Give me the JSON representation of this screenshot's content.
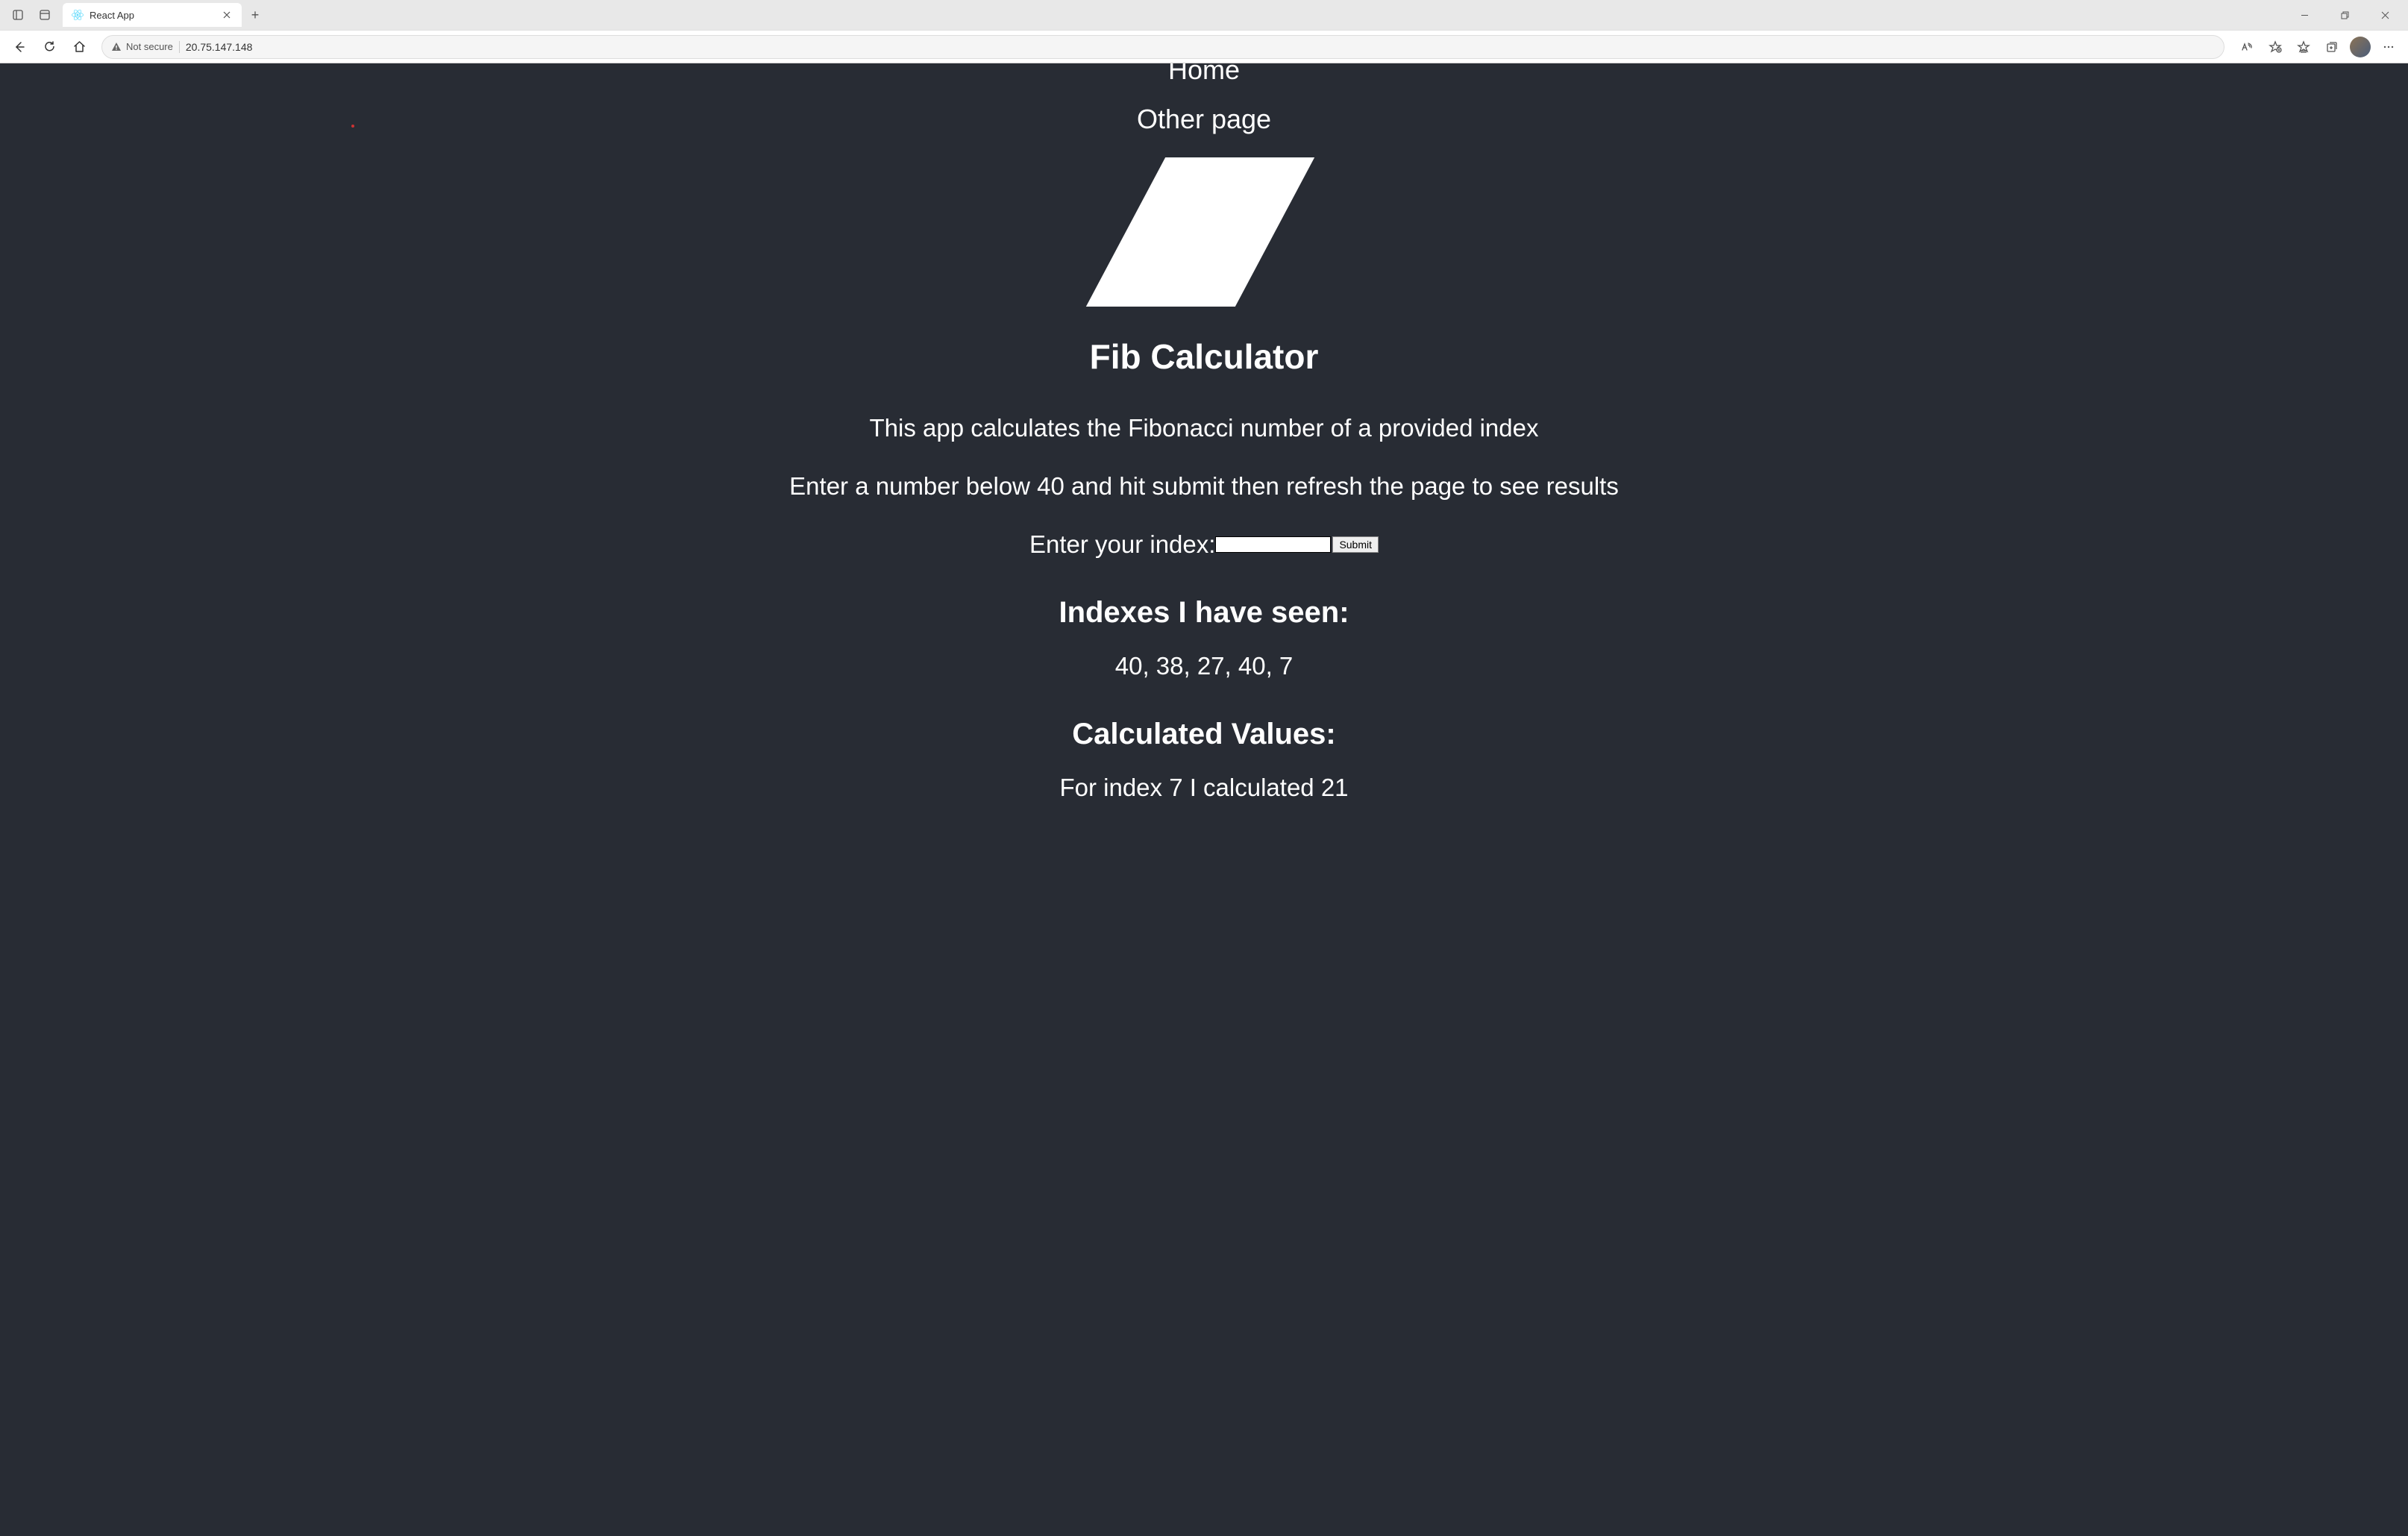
{
  "browser": {
    "tab_title": "React App",
    "security_label": "Not secure",
    "url": "20.75.147.148"
  },
  "nav": {
    "home": "Home",
    "other": "Other page"
  },
  "page": {
    "title": "Fib Calculator",
    "description": "This app calculates the Fibonacci number of a provided index",
    "instructions": "Enter a number below 40 and hit submit then refresh the page to see results",
    "input_label": "Enter your index:",
    "submit_label": "Submit",
    "indexes_heading": "Indexes I have seen:",
    "indexes_list": "40, 38, 27, 40, 7",
    "calculated_heading": "Calculated Values:",
    "calculated_value": "For index 7 I calculated 21"
  }
}
